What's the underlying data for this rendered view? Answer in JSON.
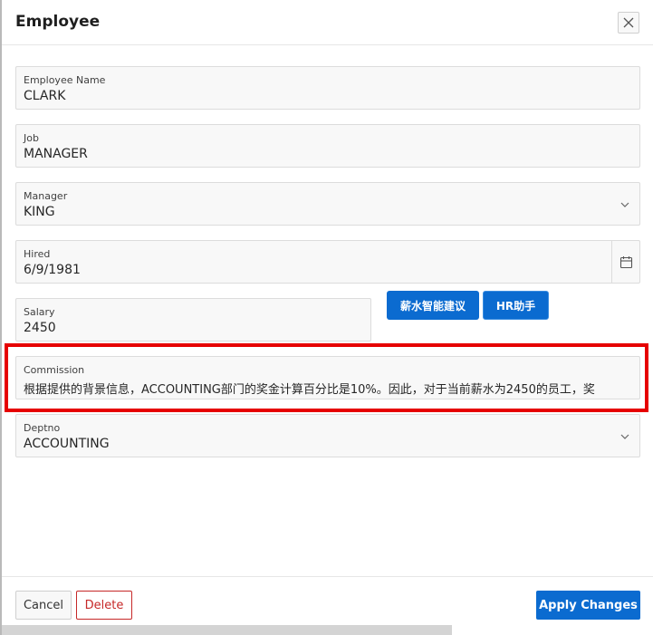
{
  "dialog": {
    "title": "Employee",
    "close_icon": "close-icon"
  },
  "fields": {
    "ename": {
      "label": "Employee Name",
      "value": "CLARK"
    },
    "job": {
      "label": "Job",
      "value": "MANAGER"
    },
    "mgr": {
      "label": "Manager",
      "value": "KING",
      "icon": "chevron-down-icon"
    },
    "hired": {
      "label": "Hired",
      "value": "6/9/1981",
      "icon": "calendar-icon"
    },
    "salary": {
      "label": "Salary",
      "value": "2450"
    },
    "comm": {
      "label": "Commission",
      "value": "根据提供的背景信息，ACCOUNTING部门的奖金计算百分比是10%。因此，对于当前薪水为2450的员工，奖"
    },
    "deptno": {
      "label": "Deptno",
      "value": "ACCOUNTING",
      "icon": "chevron-down-icon"
    }
  },
  "actions": {
    "salary_suggest": "薪水智能建议",
    "hr_assistant": "HR助手",
    "cancel": "Cancel",
    "delete": "Delete",
    "apply": "Apply Changes"
  },
  "colors": {
    "primary": "#0b6bd0",
    "danger": "#c62828",
    "highlight": "#e60000"
  }
}
